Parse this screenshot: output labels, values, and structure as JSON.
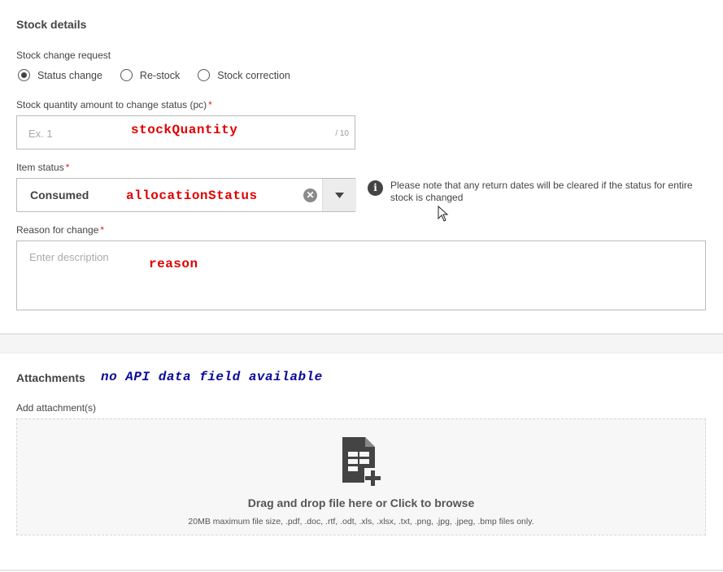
{
  "stock_details": {
    "title": "Stock details",
    "change_request": {
      "label": "Stock change request",
      "options": [
        {
          "label": "Status change",
          "checked": true
        },
        {
          "label": "Re-stock",
          "checked": false
        },
        {
          "label": "Stock correction",
          "checked": false
        }
      ]
    },
    "quantity": {
      "label": "Stock quantity amount to change status (pc)",
      "required_mark": "*",
      "placeholder": "Ex. 1",
      "overlay": "stockQuantity",
      "counter": "/ 10"
    },
    "item_status": {
      "label": "Item status",
      "required_mark": "*",
      "value": "Consumed",
      "overlay": "allocationStatus"
    },
    "note": "Please note that any return dates will be cleared if the status for entire stock is changed",
    "reason": {
      "label": "Reason for change",
      "required_mark": "*",
      "placeholder": "Enter description",
      "overlay": "reason"
    }
  },
  "attachments": {
    "title": "Attachments",
    "overlay": "no API data field available",
    "add_label": "Add attachment(s)",
    "drop_text": "Drag and drop file here or Click to browse",
    "limits": "20MB maximum file size, .pdf, .doc, .rtf, .odt, .xls, .xlsx, .txt, .png, .jpg, .jpeg, .bmp files only."
  },
  "colors": {
    "required": "#e01f26",
    "overlay_red": "#e00000",
    "overlay_blue": "#0a0a9a"
  }
}
